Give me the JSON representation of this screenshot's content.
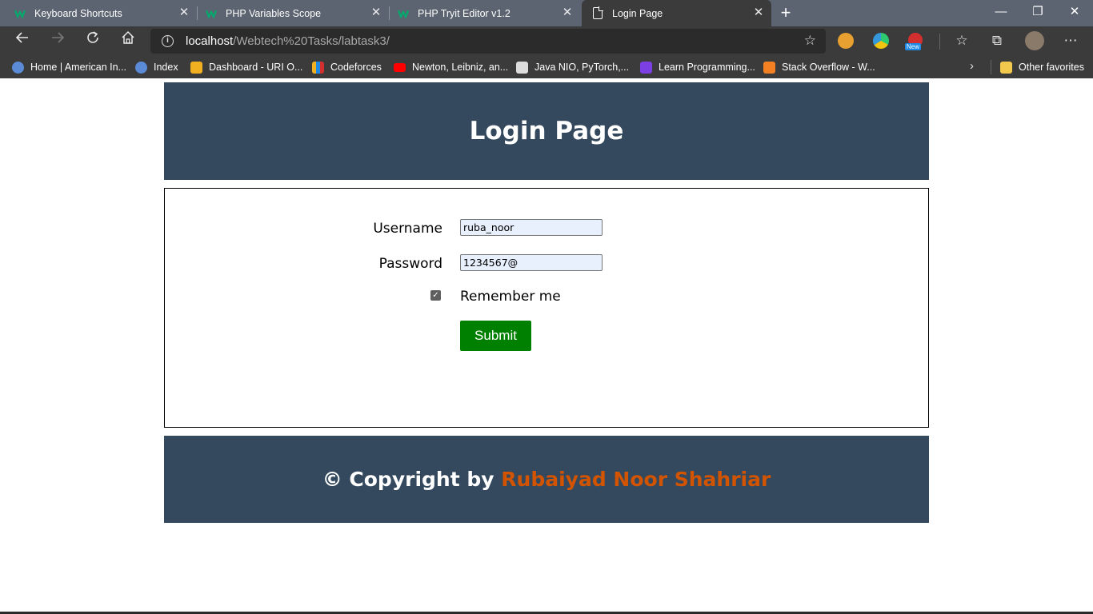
{
  "browser": {
    "tabs": [
      {
        "title": "Keyboard Shortcuts",
        "icon": "w3schools-icon"
      },
      {
        "title": "PHP Variables Scope",
        "icon": "w3schools-icon"
      },
      {
        "title": "PHP Tryit Editor v1.2",
        "icon": "w3schools-icon"
      },
      {
        "title": "Login Page",
        "icon": "document-icon",
        "active": true
      }
    ],
    "new_tab": "+",
    "window_controls": {
      "minimize": "—",
      "restore": "❐",
      "close": "✕"
    },
    "address": {
      "host": "localhost",
      "path": "/Webtech%20Tasks/labtask3/"
    },
    "extension_badge": "New",
    "bookmarks": [
      {
        "label": "Home | American In...",
        "color": "#5b8bd6"
      },
      {
        "label": "Index",
        "color": "#5b8bd6"
      },
      {
        "label": "Dashboard - URI O...",
        "color": "#f0b020"
      },
      {
        "label": "Codeforces",
        "color": "#1e88e5"
      },
      {
        "label": "Newton, Leibniz, an...",
        "color": "#ff0000"
      },
      {
        "label": "Java NIO, PyTorch,...",
        "color": "#dddddd"
      },
      {
        "label": "Learn Programming...",
        "color": "#7b3fe4"
      },
      {
        "label": "Stack Overflow - W...",
        "color": "#f48024"
      }
    ],
    "other_favorites": "Other favorites"
  },
  "page": {
    "header_title": "Login Page",
    "form": {
      "username_label": "Username",
      "username_value": "ruba_noor",
      "password_label": "Password",
      "password_value": "1234567@",
      "remember_label": "Remember me",
      "remember_checked": true,
      "submit_label": "Submit"
    },
    "footer": {
      "prefix": "© Copyright by ",
      "author": "Rubaiyad Noor Shahriar"
    }
  },
  "colors": {
    "header_bg": "#34495e",
    "submit_bg": "#008000",
    "author_accent": "#d35400"
  }
}
